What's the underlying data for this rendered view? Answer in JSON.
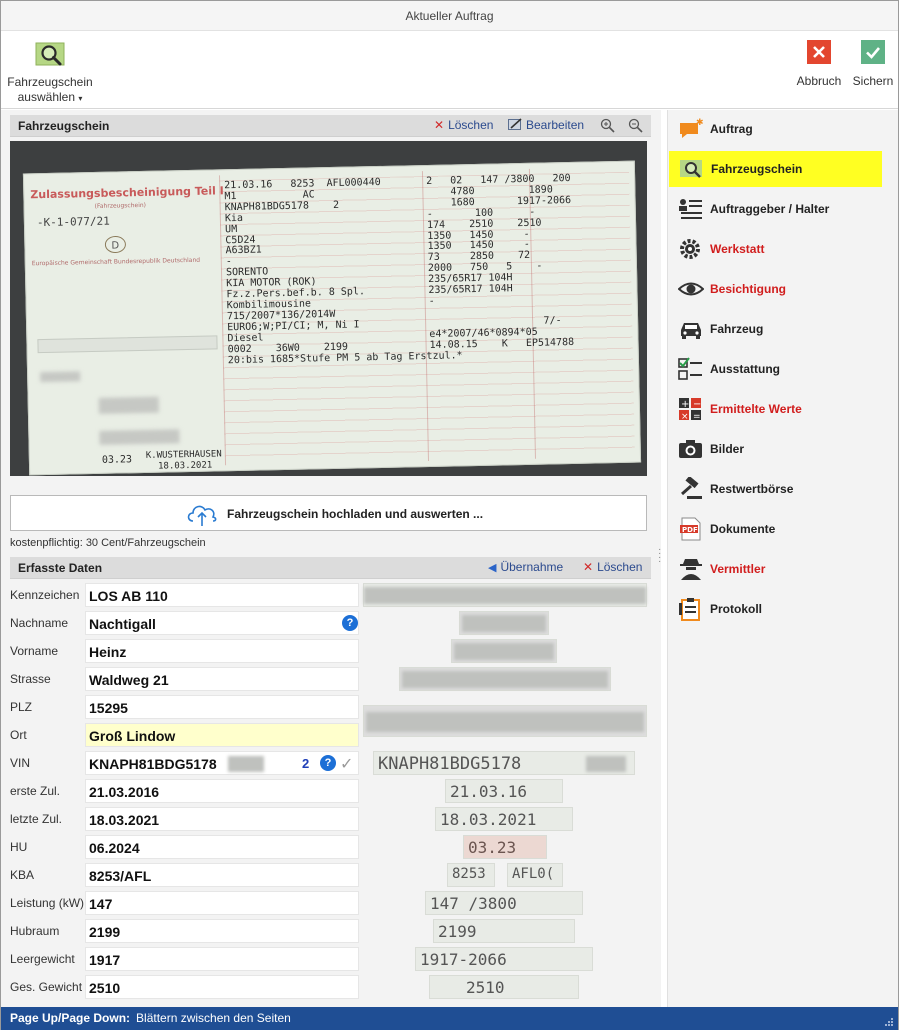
{
  "window": {
    "title": "Aktueller Auftrag"
  },
  "ribbon": {
    "select_label_line1": "Fahrzeugschein",
    "select_label_line2": "auswählen",
    "cancel_label": "Abbruch",
    "save_label": "Sichern"
  },
  "registration": {
    "title": "Fahrzeugschein",
    "delete_label": "Löschen",
    "edit_label": "Bearbeiten",
    "upload_label": "Fahrzeugschein hochladen und auswerten ...",
    "cost_note": "kostenpflichtig: 30 Cent/Fahrzeugschein",
    "document": {
      "header": "Zulassungsbescheinigung Teil I",
      "sub": "(Fahrzeugschein)",
      "number": "-K-1-077/21",
      "country": "D",
      "left_text": "Europäische Gemeinschaft   Bundesrepublik Deutschland",
      "stamp_date": "03.23",
      "authority": "K.WUSTERHAUSEN",
      "issue_date": "18.03.2021",
      "col1": "21.03.16   8253  AFL000440\nM1           AC\nKNAPH81BDG5178    2\nKia\nUM\nC5D24\nA63BZ1\n-\nSORENTO\nKIA MOTOR (ROK)\nFz.z.Pers.bef.b. 8 Spl.\nKombilimousine\n715/2007*136/2014W\nEURO6;W;PI/CI; M, Ni I\nDiesel\n0002    36W0    2199\n20:bis 1685*Stufe PM 5 ab Tag Erstzul.*",
      "col2": "2   02   147 /3800   200\n    4780         1890\n    1680       1917-2066\n-       100      -\n174    2510    2510\n1350   1450     -\n1350   1450     -\n73     2850    72\n2000   750   5    -\n235/65R17 104H\n235/65R17 104H\n-\n\n                   7/-\ne4*2007/46*0894*05\n14.08.15    K   EP514788"
    }
  },
  "captured": {
    "title": "Erfasste Daten",
    "adopt_label": "Übernahme",
    "delete_label": "Löschen",
    "fields": [
      {
        "label": "Kennzeichen",
        "value": "LOS AB 110"
      },
      {
        "label": "Nachname",
        "value": "Nachtigall"
      },
      {
        "label": "Vorname",
        "value": "Heinz"
      },
      {
        "label": "Strasse",
        "value": "Waldweg 21"
      },
      {
        "label": "PLZ",
        "value": "15295"
      },
      {
        "label": "Ort",
        "value": "Groß Lindow"
      },
      {
        "label": "VIN",
        "value": "KNAPH81BDG5178",
        "count": "2"
      },
      {
        "label": "erste Zul.",
        "value": "21.03.2016"
      },
      {
        "label": "letzte Zul.",
        "value": "18.03.2021"
      },
      {
        "label": "HU",
        "value": "06.2024"
      },
      {
        "label": "KBA",
        "value": "8253/AFL"
      },
      {
        "label": "Leistung (kW)",
        "value": "147"
      },
      {
        "label": "Hubraum",
        "value": "2199"
      },
      {
        "label": "Leergewicht",
        "value": "1917"
      },
      {
        "label": "Ges. Gewicht",
        "value": "2510"
      }
    ],
    "crops": {
      "vin": "KNAPH81BDG5178",
      "erste": "21.03.16",
      "letzte": "18.03.2021",
      "hu": "03.23",
      "kba1": "8253",
      "kba2": "AFL0(",
      "leistung": "147 /3800",
      "hubraum": "2199",
      "leergewicht": "1917-2066",
      "gesamt": "2510"
    }
  },
  "nav": [
    {
      "label": "Auftrag"
    },
    {
      "label": "Fahrzeugschein"
    },
    {
      "label": "Auftraggeber / Halter"
    },
    {
      "label": "Werkstatt"
    },
    {
      "label": "Besichtigung"
    },
    {
      "label": "Fahrzeug"
    },
    {
      "label": "Ausstattung"
    },
    {
      "label": "Ermittelte Werte"
    },
    {
      "label": "Bilder"
    },
    {
      "label": "Restwertbörse"
    },
    {
      "label": "Dokumente"
    },
    {
      "label": "Vermittler"
    },
    {
      "label": "Protokoll"
    }
  ],
  "status": {
    "key": "Page Up/Page Down:",
    "text": "Blättern zwischen den Seiten"
  },
  "colors": {
    "accent_blue": "#1f4e94",
    "active_nav": "#ffff22",
    "red_label": "#d11d1d",
    "link_blue": "#2b4a8e"
  }
}
